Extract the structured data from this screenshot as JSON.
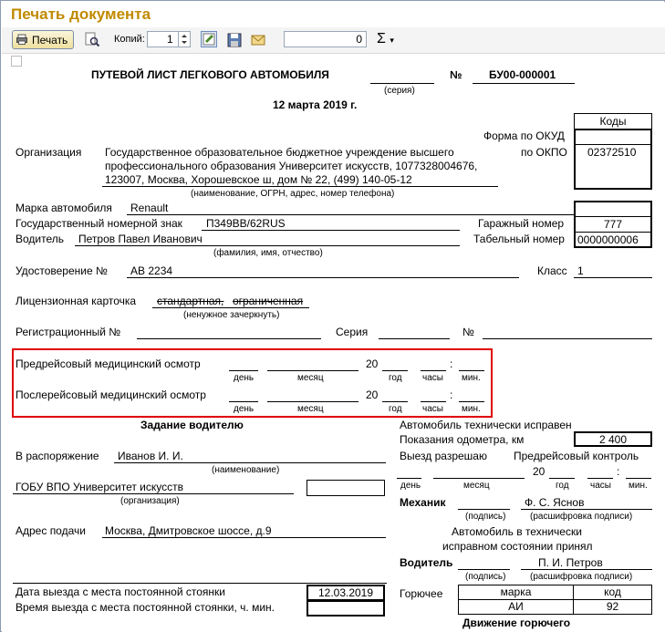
{
  "window": {
    "title": "Печать документа"
  },
  "toolbar": {
    "print_label": "Печать",
    "copies_label": "Копий:",
    "copies_value": "1",
    "number_value": "0",
    "sigma": "Σ"
  },
  "doc": {
    "header": {
      "title": "ПУТЕВОЙ ЛИСТ ЛЕГКОВОГО АВТОМОБИЛЯ",
      "series_label": "(серия)",
      "number_sign": "№",
      "number": "БУ00-000001",
      "date": "12 марта 2019 г."
    },
    "codes": {
      "header": "Коды",
      "okud_label": "Форма по ОКУД",
      "okpo_label": "по ОКПО",
      "okpo_value": "02372510"
    },
    "org": {
      "label": "Организация",
      "line1": "Государственное образовательное бюджетное учреждение высшего",
      "line2": "профессионального образования  Университет искусств, 1077328004676,",
      "line3": "123007, Москва, Хорошевское ш, дом № 22, (499) 140-05-12",
      "caption": "(наименование, ОГРН, адрес, номер телефона)"
    },
    "car": {
      "brand_label": "Марка автомобиля",
      "brand": "Renault",
      "plate_label": "Государственный номерной знак",
      "plate": "П349ВВ/62RUS",
      "garage_label": "Гаражный номер",
      "garage": "777"
    },
    "driver": {
      "label": "Водитель",
      "name": "Петров Павел Иванович",
      "caption": "(фамилия, имя, отчество)",
      "tab_label": "Табельный номер",
      "tab": "0000000006"
    },
    "license": {
      "label": "Удостоверение №",
      "value": "АВ 2234",
      "class_label": "Класс",
      "class_value": "1"
    },
    "card": {
      "label": "Лицензионная карточка",
      "text1": "стандартная,",
      "text2": "ограниченная",
      "caption": "(ненужное зачеркнуть)"
    },
    "reg": {
      "label": "Регистрационный №",
      "series": "Серия",
      "number": "№"
    },
    "medical": {
      "pre": "Предрейсовый медицинский осмотр",
      "post": "Послерейсовый медицинский осмотр",
      "twenty": "20",
      "colon": ":",
      "day": "день",
      "month": "месяц",
      "year": "год",
      "hours": "часы",
      "min": "мин."
    },
    "task": {
      "title": "Задание водителю",
      "disposal_label": "В распоряжение",
      "disposal": "Иванов И. И.",
      "name_caption": "(наименование)",
      "org": "ГОБУ ВПО Университет искусств",
      "org_caption": "(организация)",
      "addr_label": "Адрес подачи",
      "addr": "Москва, Дмитровское шоссе, д.9"
    },
    "right": {
      "ok": "Автомобиль технически исправен",
      "odo_label": "Показания одометра,  км",
      "odo": "2 400",
      "allow": "Выезд разрешаю",
      "pre_control": "Предрейсовый контроль",
      "twenty": "20",
      "colon": ":",
      "day": "день",
      "month": "месяц",
      "year": "год",
      "hours": "часы",
      "min": "мин.",
      "mechanic_label": "Механик",
      "mechanic": "Ф. С. Яснов",
      "sign": "(подпись)",
      "decode": "(расшифровка подписи)",
      "accepted1": "Автомобиль в технически",
      "accepted2": "исправном состоянии принял",
      "driver_label": "Водитель",
      "driver": "П. И. Петров",
      "fuel_label": "Горючее",
      "fuel_brand_h": "марка",
      "fuel_code_h": "код",
      "fuel_brand": "АИ",
      "fuel_code": "92",
      "fuel_move": "Движение горючего"
    },
    "bottom": {
      "departure_label": "Дата выезда с места постоянной стоянки",
      "departure": "12.03.2019",
      "time_label": "Время выезда с места постоянной стоянки, ч. мин."
    }
  }
}
